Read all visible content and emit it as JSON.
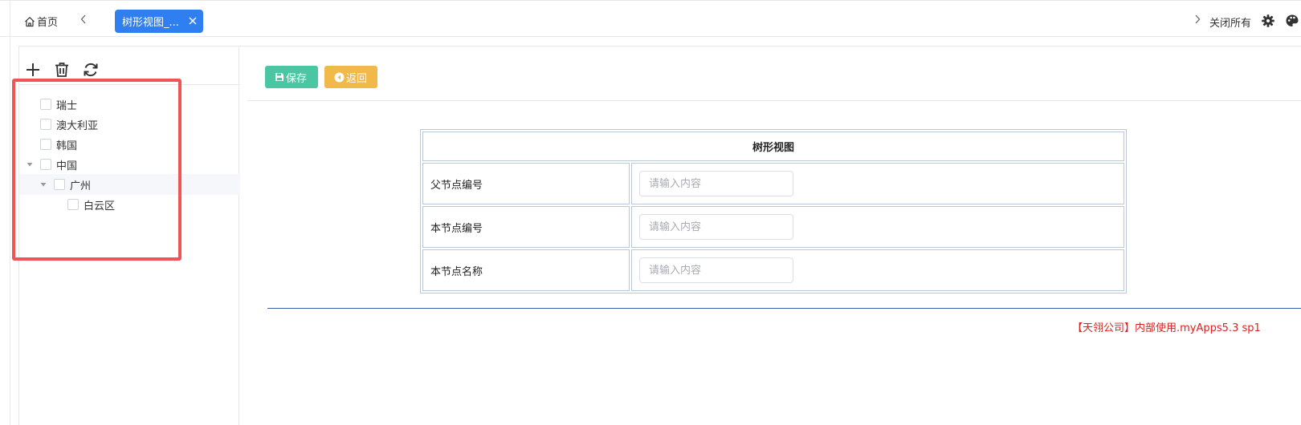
{
  "tabs": {
    "home_label": "首页",
    "active_label": "树形视图_...",
    "close_all_label": "关闭所有"
  },
  "tree": {
    "nodes": [
      {
        "label": "瑞士",
        "expanded": false
      },
      {
        "label": "澳大利亚",
        "expanded": false
      },
      {
        "label": "韩国",
        "expanded": false
      },
      {
        "label": "中国",
        "expanded": true
      },
      {
        "label": "广州",
        "expanded": true,
        "selected": true
      },
      {
        "label": "白云区",
        "expanded": false
      }
    ]
  },
  "toolbar": {
    "save_label": "保存",
    "back_label": "返回"
  },
  "form": {
    "title": "树形视图",
    "fields": [
      {
        "label": "父节点编号",
        "placeholder": "请输入内容",
        "value": ""
      },
      {
        "label": "本节点编号",
        "placeholder": "请输入内容",
        "value": ""
      },
      {
        "label": "本节点名称",
        "placeholder": "请输入内容",
        "value": ""
      }
    ]
  },
  "footer": {
    "note": "【天翎公司】内部使用.myApps5.3 sp1"
  },
  "colors": {
    "accent_tab": "#2f7ff0",
    "save_button": "#4bc6a3",
    "back_button": "#f1b84a",
    "highlight": "#f05454",
    "footer_text": "#e02020"
  }
}
